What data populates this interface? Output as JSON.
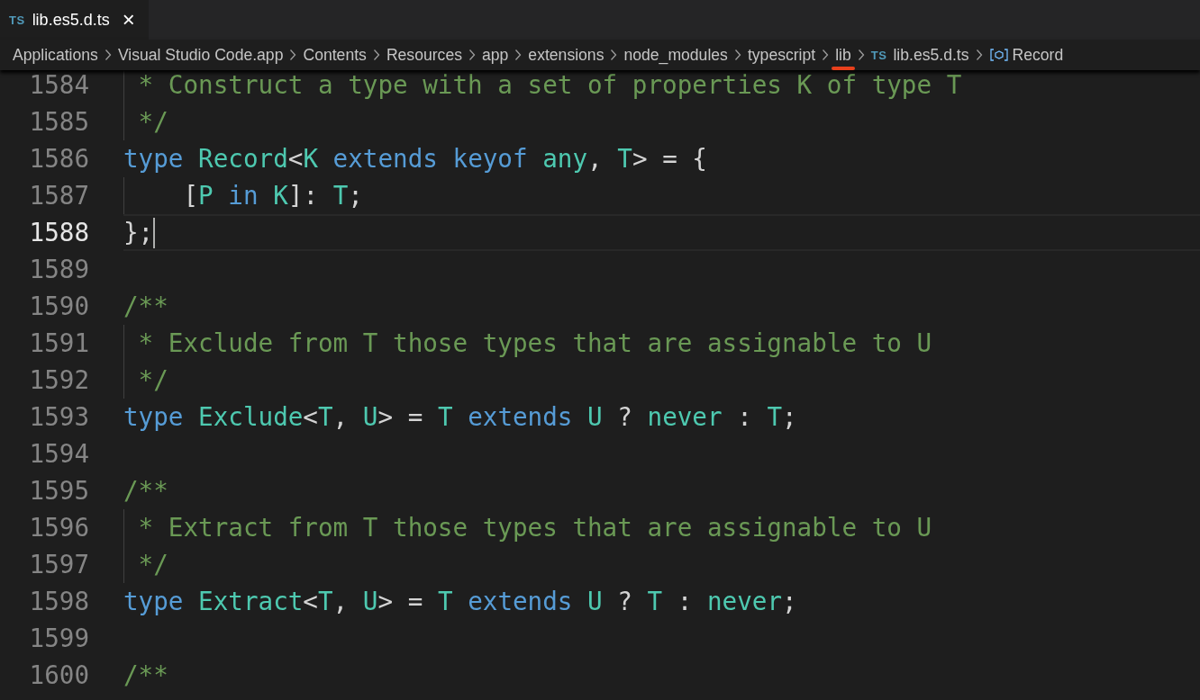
{
  "tabs": [
    {
      "icon_text": "TS",
      "label": "lib.es5.d.ts",
      "close": "×",
      "selected": true
    }
  ],
  "breadcrumbs": [
    {
      "kind": "folder",
      "label": "Applications",
      "marked": false
    },
    {
      "kind": "folder",
      "label": "Visual Studio Code.app",
      "marked": false
    },
    {
      "kind": "folder",
      "label": "Contents",
      "marked": false
    },
    {
      "kind": "folder",
      "label": "Resources",
      "marked": false
    },
    {
      "kind": "folder",
      "label": "app",
      "marked": false
    },
    {
      "kind": "folder",
      "label": "extensions",
      "marked": false
    },
    {
      "kind": "folder",
      "label": "node_modules",
      "marked": false
    },
    {
      "kind": "folder",
      "label": "typescript",
      "marked": false
    },
    {
      "kind": "folder",
      "label": "lib",
      "marked": true
    },
    {
      "kind": "file",
      "icon_text": "TS",
      "label": "lib.es5.d.ts",
      "marked": false
    },
    {
      "kind": "symbol",
      "label": "Record",
      "marked": false
    }
  ],
  "lines": [
    {
      "number": "1584",
      "current": false,
      "tokens": [
        {
          "kind": "comment",
          "text": " * Construct a type with a set of properties K of type T"
        }
      ]
    },
    {
      "number": "1585",
      "current": false,
      "tokens": [
        {
          "kind": "comment",
          "text": " */"
        }
      ]
    },
    {
      "number": "1586",
      "current": false,
      "tokens": [
        {
          "kind": "keyword",
          "text": "type"
        },
        {
          "kind": "type",
          "text": " Record"
        },
        {
          "kind": "plain",
          "text": "<"
        },
        {
          "kind": "type",
          "text": "K"
        },
        {
          "kind": "keyword",
          "text": " extends"
        },
        {
          "kind": "keyword",
          "text": " keyof"
        },
        {
          "kind": "type",
          "text": " any"
        },
        {
          "kind": "plain",
          "text": ", "
        },
        {
          "kind": "type",
          "text": "T"
        },
        {
          "kind": "plain",
          "text": "> = {"
        }
      ]
    },
    {
      "number": "1587",
      "current": false,
      "tokens": [
        {
          "kind": "plain",
          "text": "    ["
        },
        {
          "kind": "type",
          "text": "P"
        },
        {
          "kind": "keyword",
          "text": " in"
        },
        {
          "kind": "type",
          "text": " K"
        },
        {
          "kind": "plain",
          "text": "]: "
        },
        {
          "kind": "type",
          "text": "T"
        },
        {
          "kind": "plain",
          "text": ";"
        }
      ]
    },
    {
      "number": "1588",
      "current": true,
      "tokens": [
        {
          "kind": "plain",
          "text": "};"
        }
      ]
    },
    {
      "number": "1589",
      "current": false
    },
    {
      "number": "1590",
      "current": false,
      "tokens": [
        {
          "kind": "comment",
          "text": "/**"
        }
      ]
    },
    {
      "number": "1591",
      "current": false,
      "tokens": [
        {
          "kind": "comment",
          "text": " * Exclude from T those types that are assignable to U"
        }
      ]
    },
    {
      "number": "1592",
      "current": false,
      "tokens": [
        {
          "kind": "comment",
          "text": " */"
        }
      ]
    },
    {
      "number": "1593",
      "current": false,
      "tokens": [
        {
          "kind": "keyword",
          "text": "type"
        },
        {
          "kind": "type",
          "text": " Exclude"
        },
        {
          "kind": "plain",
          "text": "<"
        },
        {
          "kind": "type",
          "text": "T"
        },
        {
          "kind": "plain",
          "text": ", "
        },
        {
          "kind": "type",
          "text": "U"
        },
        {
          "kind": "plain",
          "text": "> = "
        },
        {
          "kind": "type",
          "text": "T"
        },
        {
          "kind": "keyword",
          "text": " extends"
        },
        {
          "kind": "type",
          "text": " U"
        },
        {
          "kind": "plain",
          "text": " ? "
        },
        {
          "kind": "type",
          "text": "never"
        },
        {
          "kind": "plain",
          "text": " : "
        },
        {
          "kind": "type",
          "text": "T"
        },
        {
          "kind": "plain",
          "text": ";"
        }
      ]
    },
    {
      "number": "1594",
      "current": false
    },
    {
      "number": "1595",
      "current": false,
      "tokens": [
        {
          "kind": "comment",
          "text": "/**"
        }
      ]
    },
    {
      "number": "1596",
      "current": false,
      "tokens": [
        {
          "kind": "comment",
          "text": " * Extract from T those types that are assignable to U"
        }
      ]
    },
    {
      "number": "1597",
      "current": false,
      "tokens": [
        {
          "kind": "comment",
          "text": " */"
        }
      ]
    },
    {
      "number": "1598",
      "current": false,
      "tokens": [
        {
          "kind": "keyword",
          "text": "type"
        },
        {
          "kind": "type",
          "text": " Extract"
        },
        {
          "kind": "plain",
          "text": "<"
        },
        {
          "kind": "type",
          "text": "T"
        },
        {
          "kind": "plain",
          "text": ", "
        },
        {
          "kind": "type",
          "text": "U"
        },
        {
          "kind": "plain",
          "text": "> = "
        },
        {
          "kind": "type",
          "text": "T"
        },
        {
          "kind": "keyword",
          "text": " extends"
        },
        {
          "kind": "type",
          "text": " U"
        },
        {
          "kind": "plain",
          "text": " ? "
        },
        {
          "kind": "type",
          "text": "T"
        },
        {
          "kind": "plain",
          "text": " : "
        },
        {
          "kind": "type",
          "text": "never"
        },
        {
          "kind": "plain",
          "text": ";"
        }
      ]
    },
    {
      "number": "1599",
      "current": false
    },
    {
      "number": "1600",
      "current": false,
      "tokens": [
        {
          "kind": "comment",
          "text": "/**"
        }
      ]
    }
  ]
}
